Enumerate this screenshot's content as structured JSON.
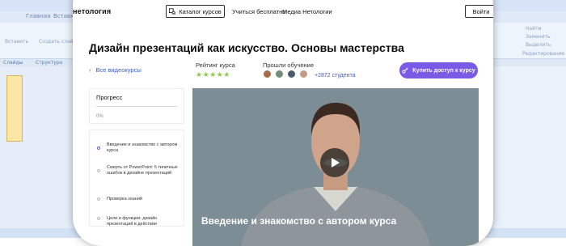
{
  "background_app": {
    "tabs": [
      "Главная",
      "Вставка"
    ],
    "ribbon_left": [
      "Вставить",
      "Создать слайд"
    ],
    "ribbon_right": [
      "Найти",
      "Заменить",
      "Выделить",
      "Редактирование"
    ],
    "pane_tabs": [
      "Слайды",
      "Структура"
    ]
  },
  "header": {
    "logo": "нетология",
    "catalog_label": "Каталог курсов",
    "study_free_label": "Учиться бесплатно",
    "media_label": "Медиа Нетологии",
    "login_label": "Войти"
  },
  "course": {
    "title": "Дизайн презентаций как искусство. Основы мастерства",
    "back_label": "Все видеокурсы",
    "rating_label": "Рейтинг курса",
    "rating_stars": 5,
    "passed_label": "Прошли обучение",
    "students_count": "+2872 студента",
    "buy_label": "Купить доступ к курсу"
  },
  "progress": {
    "title": "Прогресс",
    "value_text": "0%",
    "value": 0
  },
  "lessons": [
    "Введение и знакомство с автором курса",
    "Смерть от PowerPoint: 5 типичных ошибок в дизайне презентаций",
    "Проверка знаний",
    "Цели и функции: дизайн презентаций в действии"
  ],
  "video": {
    "caption": "Введение и знакомство с автором курса"
  },
  "colors": {
    "accent": "#7a5be6",
    "link": "#3d5ccc",
    "star": "#8ccc4a",
    "video_bg": "#7c8d95"
  }
}
